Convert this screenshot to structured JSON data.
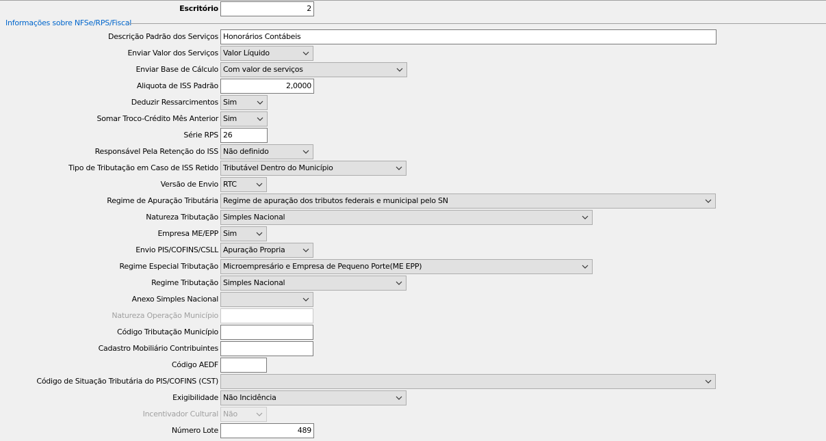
{
  "header": {
    "office_label": "Escritório",
    "office_value": "2"
  },
  "section_title": "Informações sobre NFSe/RPS/Fiscal",
  "fields": {
    "descricao": {
      "label": "Descrição Padrão dos Serviços",
      "value": "Honorários Contábeis"
    },
    "enviar_valor": {
      "label": "Enviar Valor dos Serviços",
      "value": "Valor Líquido"
    },
    "enviar_base": {
      "label": "Enviar Base de Cálculo",
      "value": "Com valor de serviços"
    },
    "aliquota": {
      "label": "Aliquota de ISS Padrão",
      "value": "2,0000"
    },
    "deduzir": {
      "label": "Deduzir Ressarcimentos",
      "value": "Sim"
    },
    "somar_troco": {
      "label": "Somar Troco-Crédito Mês Anterior",
      "value": "Sim"
    },
    "serie_rps": {
      "label": "Série RPS",
      "value": "26"
    },
    "responsavel": {
      "label": "Responsável Pela Retenção do ISS",
      "value": "Não definido"
    },
    "tipo_tributacao": {
      "label": "Tipo de Tributação em Caso de ISS Retido",
      "value": "Tributável Dentro do Município"
    },
    "versao_envio": {
      "label": "Versão de Envio",
      "value": "RTC"
    },
    "regime_apuracao": {
      "label": "Regime de Apuração Tributária",
      "value": "Regime de apuração dos tributos federais e municipal pelo SN"
    },
    "natureza_tributacao": {
      "label": "Natureza Tributação",
      "value": "Simples Nacional"
    },
    "empresa_me": {
      "label": "Empresa ME/EPP",
      "value": "Sim"
    },
    "envio_pis": {
      "label": "Envio PIS/COFINS/CSLL",
      "value": "Apuração Propria"
    },
    "regime_especial": {
      "label": "Regime Especial Tributação",
      "value": "Microempresário e Empresa de Pequeno Porte(ME EPP)"
    },
    "regime_tributacao": {
      "label": "Regime Tributação",
      "value": "Simples Nacional"
    },
    "anexo_simples": {
      "label": "Anexo Simples Nacional",
      "value": ""
    },
    "natureza_operacao": {
      "label": "Natureza Operação Município",
      "value": ""
    },
    "codigo_tributacao": {
      "label": "Código Tributação Município",
      "value": ""
    },
    "cadastro_mobiliario": {
      "label": "Cadastro Mobiliário Contribuintes",
      "value": ""
    },
    "codigo_aedf": {
      "label": "Código AEDF",
      "value": ""
    },
    "codigo_cst": {
      "label": "Código de Situação Tributária do PIS/COFINS (CST)",
      "value": ""
    },
    "exigibilidade": {
      "label": "Exigibilidade",
      "value": "Não Incidência"
    },
    "incentivador": {
      "label": "Incentivador Cultural",
      "value": "Não"
    },
    "numero_lote": {
      "label": "Número Lote",
      "value": "489"
    }
  },
  "icons": {
    "dropdown": "chevron-down-icon"
  }
}
